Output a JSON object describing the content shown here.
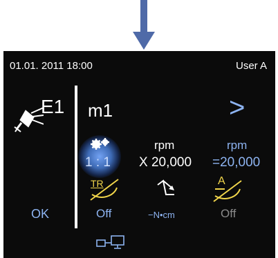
{
  "status_bar": {
    "datetime": "01.01. 2011 18:00",
    "user": "User A"
  },
  "header": {
    "program_badge": "E1",
    "mode_label": "m1",
    "next_symbol": ">"
  },
  "gear": {
    "ratio": "1 : 1"
  },
  "speed": {
    "unit_left": "rpm",
    "factor": "X 20,000",
    "unit_right": "rpm",
    "result": "=20,000"
  },
  "footer": {
    "ok_label": "OK",
    "tr_symbol": "TR",
    "tr_state": "Off",
    "torque_unit": "−N•cm",
    "a_symbol": "A",
    "a_state": "Off"
  },
  "colors": {
    "accent_blue": "#8db3f0",
    "screen_bg": "#0b0b0b",
    "arrow": "#4f6aa8"
  }
}
